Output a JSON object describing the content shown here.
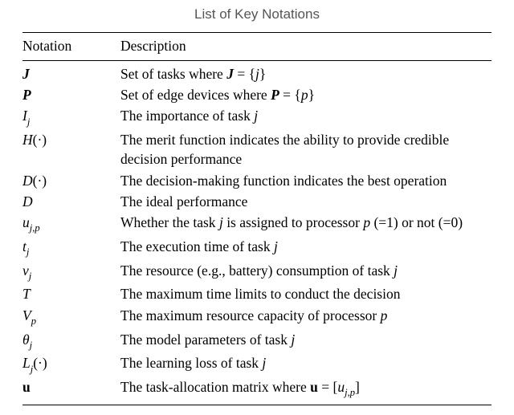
{
  "title": "List of Key Notations",
  "header": {
    "notation": "Notation",
    "description": "Description"
  },
  "rows": {
    "r0": {
      "notation_html": "<span class='bi'>J</span>",
      "desc_html": "Set of tasks where <span class='bi'>J</span> = {<span class='it'>j</span>}"
    },
    "r1": {
      "notation_html": "<span class='bi'>P</span>",
      "desc_html": "Set of edge devices where <span class='bi'>P</span> = {<span class='it'>p</span>}"
    },
    "r2": {
      "notation_html": "<span class='cal'>I</span><span class='sub it'>j</span>",
      "desc_html": "The importance of task <span class='it'>j</span>"
    },
    "r3": {
      "notation_html": "<span class='cal'>H</span>(&middot;)",
      "desc_html": "The merit function indicates the ability to provide credible decision performance"
    },
    "r4": {
      "notation_html": "<span class='cal'>D</span>(&middot;)",
      "desc_html": "The decision-making function indicates the best operation"
    },
    "r5": {
      "notation_html": "<span class='it'>D</span>",
      "desc_html": "The ideal performance"
    },
    "r6": {
      "notation_html": "<span class='it'>u</span><span class='sub'><span class='it'>j</span>,<span class='it'>p</span></span>",
      "desc_html": "Whether the task <span class='it'>j</span> is assigned to processor <span class='it'>p</span> (=1) or not (=0)"
    },
    "r7": {
      "notation_html": "<span class='it'>t</span><span class='sub it'>j</span>",
      "desc_html": "The execution time of task <span class='it'>j</span>"
    },
    "r8": {
      "notation_html": "<span class='it'>v</span><span class='sub it'>j</span>",
      "desc_html": "The resource (e.g., battery) consumption of task <span class='it'>j</span>"
    },
    "r9": {
      "notation_html": "<span class='it'>T</span>",
      "desc_html": "The maximum time limits to conduct the decision"
    },
    "r10": {
      "notation_html": "<span class='it'>V</span><span class='sub it'>p</span>",
      "desc_html": "The maximum resource capacity of processor <span class='it'>p</span>"
    },
    "r11": {
      "notation_html": "<span class='it'>&theta;</span><span class='sub it'>j</span>",
      "desc_html": "The model parameters of task <span class='it'>j</span>"
    },
    "r12": {
      "notation_html": "<span class='it'>L</span><span class='sub it'>j</span>(&middot;)",
      "desc_html": "The learning loss of task <span class='it'>j</span>"
    },
    "r13": {
      "notation_html": "<span class='bf'>u</span>",
      "desc_html": "The task-allocation matrix where <span class='bf'>u</span> = [<span class='it'>u</span><span class='sub'><span class='it'>j</span>,<span class='it'>p</span></span>]"
    }
  }
}
